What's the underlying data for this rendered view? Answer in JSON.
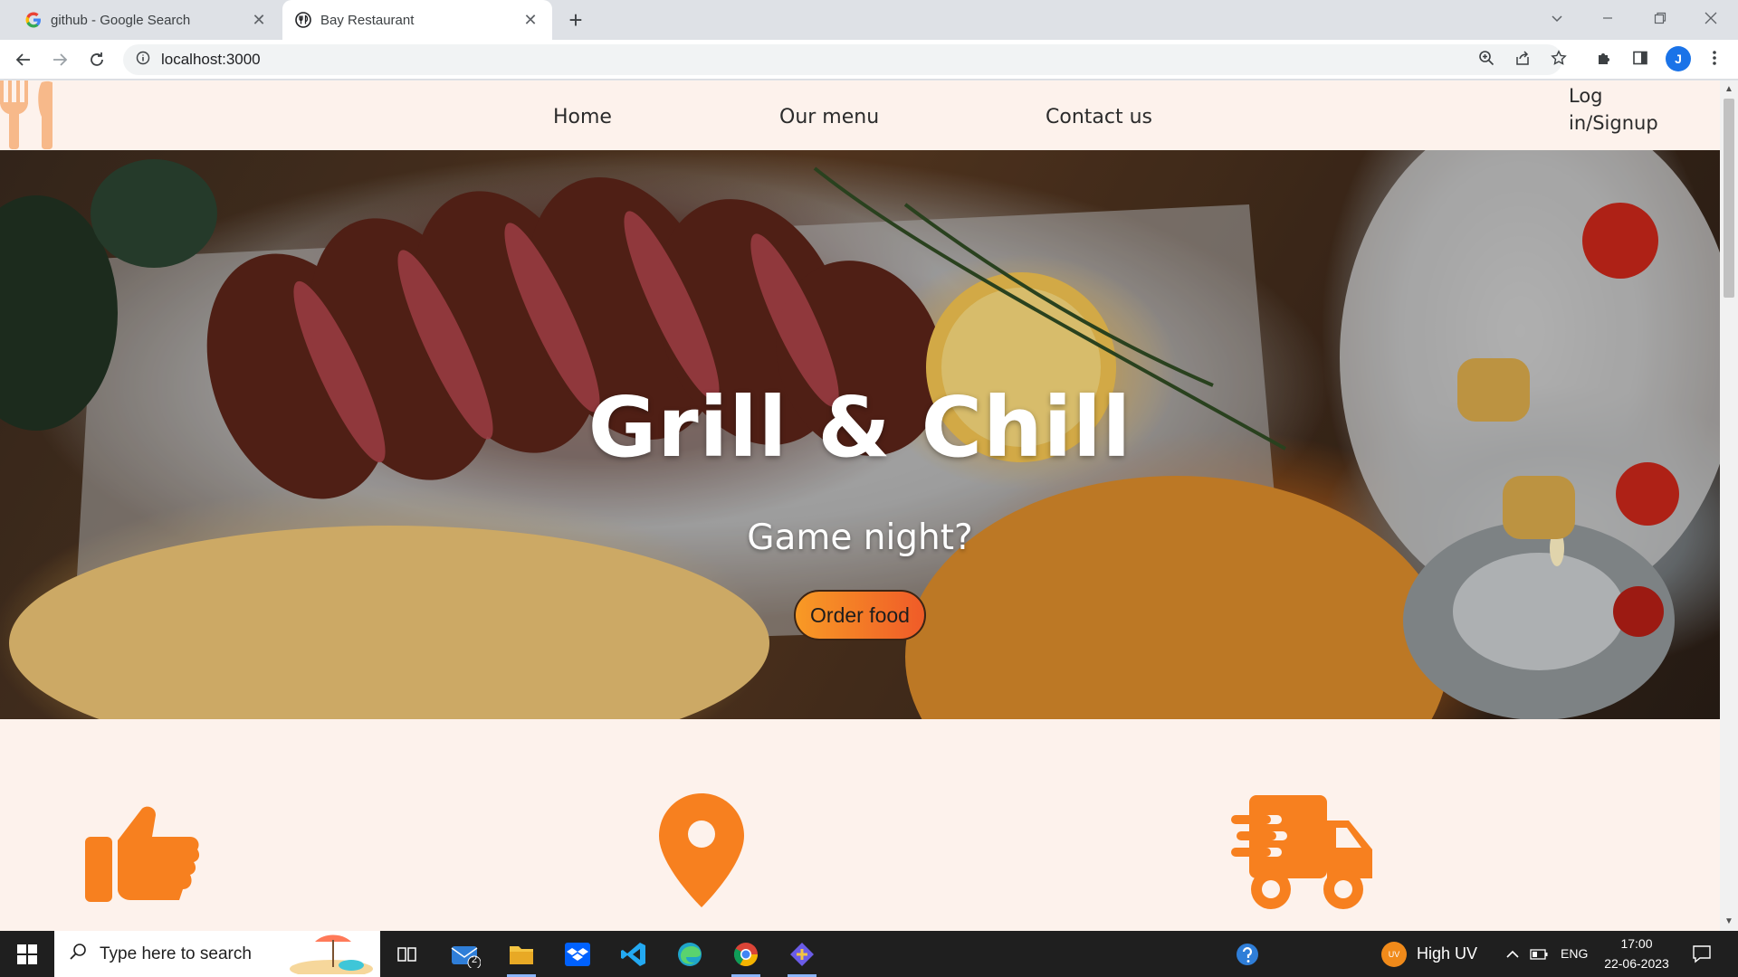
{
  "browser": {
    "tabs": [
      {
        "title": "github - Google Search",
        "active": false
      },
      {
        "title": "Bay Restaurant",
        "active": true
      }
    ],
    "url": "localhost:3000",
    "profile_initial": "J"
  },
  "site": {
    "nav": {
      "home": "Home",
      "menu": "Our menu",
      "contact": "Contact us",
      "login": "Log in/Signup"
    },
    "hero": {
      "title": "Grill & Chill",
      "subtitle": "Game night?",
      "cta": "Order food"
    },
    "features": [
      {
        "icon": "thumbs-up-icon"
      },
      {
        "icon": "location-pin-icon"
      },
      {
        "icon": "delivery-truck-icon"
      }
    ]
  },
  "colors": {
    "accent_orange": "#f7801f",
    "page_bg": "#fdf2ec",
    "button_gradient_start": "#f89a25",
    "button_gradient_end": "#ef5b28"
  },
  "taskbar": {
    "search_placeholder": "Type here to search",
    "mail_badge": "2",
    "weather": "High UV",
    "weather_badge": "UV",
    "language": "ENG",
    "time": "17:00",
    "date": "22-06-2023"
  }
}
